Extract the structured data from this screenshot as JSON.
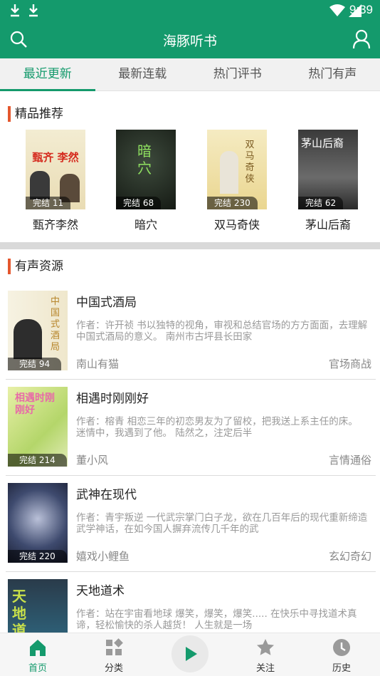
{
  "status_bar": {
    "time": "9:39"
  },
  "app_bar": {
    "title": "海豚听书"
  },
  "tabs": [
    {
      "label": "最近更新",
      "active": true
    },
    {
      "label": "最新连载",
      "active": false
    },
    {
      "label": "热门评书",
      "active": false
    },
    {
      "label": "热门有声",
      "active": false
    }
  ],
  "featured": {
    "heading": "精品推荐",
    "items": [
      {
        "title": "甄齐李然",
        "badge": "完结 11",
        "cover_text": "甄齐 李然"
      },
      {
        "title": "暗穴",
        "badge": "完结 68",
        "cover_text": "暗穴"
      },
      {
        "title": "双马奇侠",
        "badge": "完结 230",
        "cover_text": "双马奇侠"
      },
      {
        "title": "茅山后裔",
        "badge": "完结 62",
        "cover_text": "茅山后裔"
      }
    ]
  },
  "audio": {
    "heading": "有声资源",
    "items": [
      {
        "title": "中国式酒局",
        "desc": "作者：许开祯 书以独特的视角，审视和总结官场的方方面面，去理解中国式酒局的意义。 南州市古坪县长田家",
        "author": "南山有猫",
        "category": "官场商战",
        "badge": "完结 94",
        "cover_text": "中国式酒局"
      },
      {
        "title": "相遇时刚刚好",
        "desc": "作者：榕青 相恋三年的初恋男友为了留校，把我送上系主任的床。 迷情中，我遇到了他。 陆然之，注定后半",
        "author": "董小风",
        "category": "言情通俗",
        "badge": "完结 214",
        "cover_text": "相遇时刚刚好"
      },
      {
        "title": "武神在现代",
        "desc": "作者：青宇叛逆 一代武宗掌门白子龙，欲在几百年后的现代重新缔造武学神话，在如今国人摒弃流传几千年的武",
        "author": "嬉戏小鲤鱼",
        "category": "玄幻奇幻",
        "badge": "完结 220",
        "cover_text": ""
      },
      {
        "title": "天地道术",
        "desc": "作者：站在宇宙看地球 爆笑，爆笑，爆笑..... 在快乐中寻找道术真谛，轻松愉快的杀人越货！ 人生就是一场",
        "author": "",
        "category": "",
        "badge": "",
        "cover_text": "天地道术"
      }
    ]
  },
  "bottom_nav": [
    {
      "label": "首页",
      "icon": "home-icon",
      "active": true
    },
    {
      "label": "分类",
      "icon": "category-icon",
      "active": false
    },
    {
      "label": "",
      "icon": "play-icon",
      "active": false
    },
    {
      "label": "关注",
      "icon": "star-icon",
      "active": false
    },
    {
      "label": "历史",
      "icon": "history-icon",
      "active": false
    }
  ],
  "colors": {
    "accent": "#149a6c",
    "section_bar": "#e4572e"
  }
}
